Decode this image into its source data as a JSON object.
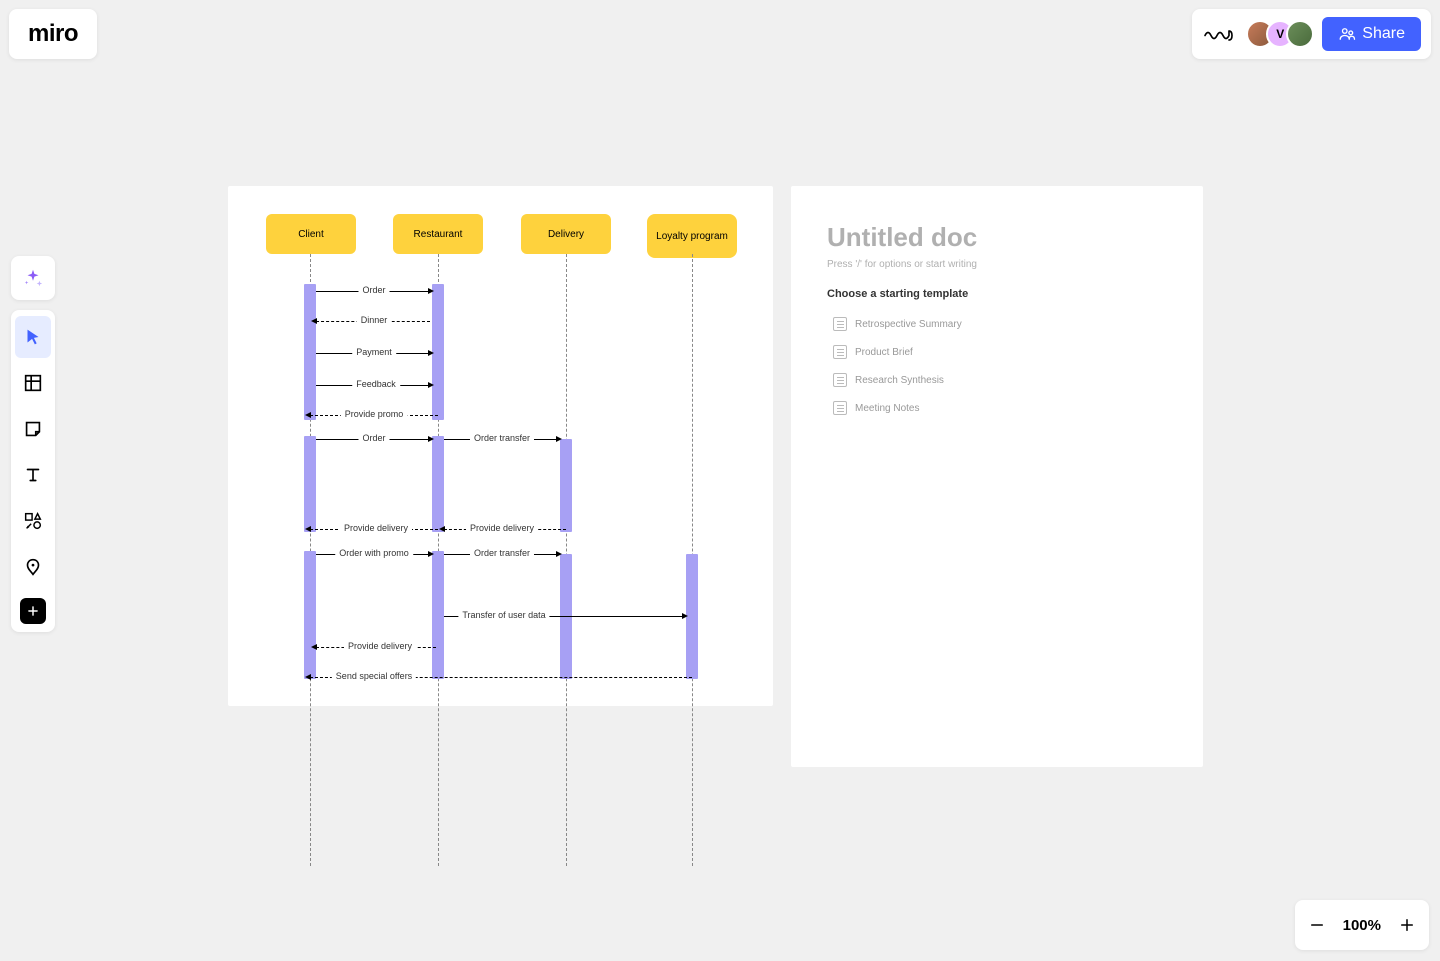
{
  "app": {
    "logo": "miro"
  },
  "header": {
    "avatar_initial": "V",
    "share_label": "Share"
  },
  "toolbar": {
    "tools": [
      "ai",
      "select",
      "frame",
      "sticky",
      "text",
      "shapes",
      "pen",
      "more"
    ]
  },
  "zoom": {
    "level": "100%"
  },
  "diagram": {
    "participants": {
      "client": "Client",
      "restaurant": "Restaurant",
      "delivery": "Delivery",
      "loyalty": "Loyalty program"
    },
    "messages": {
      "m1": "Order",
      "m2": "Dinner",
      "m3": "Payment",
      "m4": "Feedback",
      "m5": "Provide promo",
      "m6": "Order",
      "m7": "Order transfer",
      "m8": "Provide delivery",
      "m9": "Provide delivery",
      "m10": "Order with promo",
      "m11": "Order transfer",
      "m12": "Transfer of user data",
      "m13": "Provide delivery",
      "m14": "Send special offers"
    }
  },
  "doc": {
    "title": "Untitled doc",
    "hint": "Press '/' for options or start writing",
    "section_label": "Choose a starting template",
    "templates": {
      "t1": "Retrospective Summary",
      "t2": "Product Brief",
      "t3": "Research Synthesis",
      "t4": "Meeting Notes"
    }
  }
}
